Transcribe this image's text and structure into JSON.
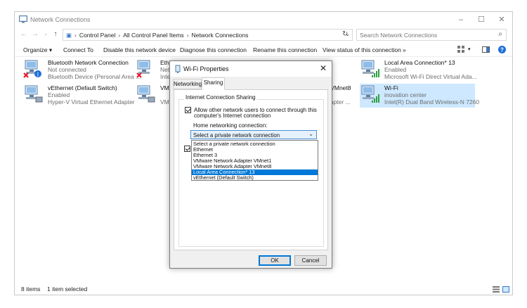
{
  "window": {
    "title": "Network Connections"
  },
  "address": {
    "crumbs": [
      "Control Panel",
      "All Control Panel Items",
      "Network Connections"
    ],
    "search_placeholder": "Search Network Connections"
  },
  "commands": {
    "organize": "Organize",
    "connect_to": "Connect To",
    "disable": "Disable this network device",
    "diagnose": "Diagnose this connection",
    "rename": "Rename this connection",
    "view_status": "View status of this connection",
    "more": "»"
  },
  "connections": [
    {
      "name": "Bluetooth Network Connection",
      "status": "Not connected",
      "device": "Bluetooth Device (Personal Area ..."
    },
    {
      "name": "Ethe",
      "status": "Netw",
      "device": "Intel"
    },
    {
      "name": "",
      "status": "",
      "device": ""
    },
    {
      "name": "Local Area Connection* 13",
      "status": "Enabled",
      "device": "Microsoft Wi-Fi Direct Virtual Ada..."
    },
    {
      "name": "vEthernet (Default Switch)",
      "status": "Enabled",
      "device": "Hyper-V Virtual Ethernet Adapter"
    },
    {
      "name": "VMw",
      "status": "",
      "device": "VMw"
    },
    {
      "name": "r VMnet8",
      "status": "",
      "device": "dapter ..."
    },
    {
      "name": "Wi-Fi",
      "status": "inovation center",
      "device": "Intel(R) Dual Band Wireless-N 7260"
    }
  ],
  "status": {
    "items": "8 items",
    "selected": "1 item selected"
  },
  "dialog": {
    "title": "Wi-Fi Properties",
    "close": "✕",
    "tabs": [
      "Networking",
      "Sharing"
    ],
    "group_title": "Internet Connection Sharing",
    "allow_line1": "Allow other network users to connect through this",
    "allow_line2": "computer's Internet connection",
    "home_label": "Home networking connection:",
    "selected_value": "Select a private network connection",
    "options": [
      "Select a private network connection",
      "Ethernet",
      "Ethernet 3",
      "VMware Network Adapter VMnet1",
      "VMware Network Adapter VMnet8",
      "Local Area Connection* 13",
      "vEthernet (Default Switch)"
    ],
    "highlighted_option": "Local Area Connection* 13",
    "ok": "OK",
    "cancel": "Cancel"
  },
  "colors": {
    "accent": "#0078d7",
    "selection": "#cde8ff",
    "error": "#e81123",
    "signal": "#2ea043"
  }
}
